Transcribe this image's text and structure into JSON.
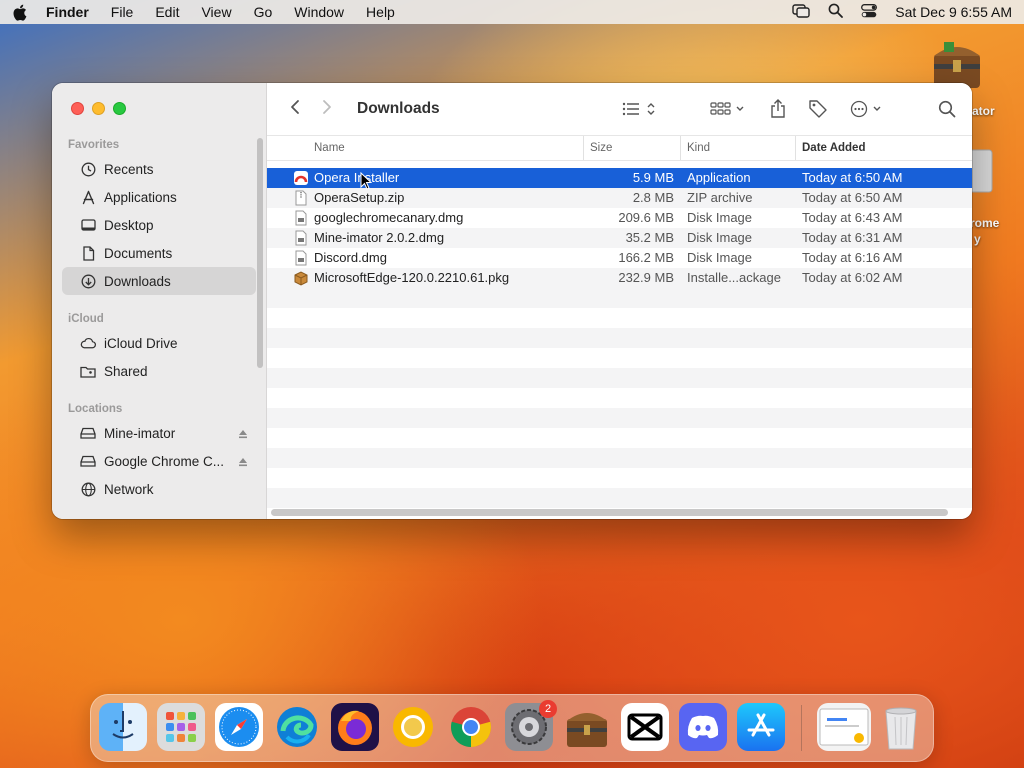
{
  "menubar": {
    "app_name": "Finder",
    "items": [
      "File",
      "Edit",
      "View",
      "Go",
      "Window",
      "Help"
    ],
    "datetime": "Sat Dec 9  6:55 AM"
  },
  "window": {
    "title": "Downloads",
    "sidebar": {
      "favorites_label": "Favorites",
      "favorites": [
        "Recents",
        "Applications",
        "Desktop",
        "Documents",
        "Downloads"
      ],
      "icloud_label": "iCloud",
      "icloud": [
        "iCloud Drive",
        "Shared"
      ],
      "locations_label": "Locations",
      "locations": [
        "Mine-imator",
        "Google Chrome C...",
        "Network"
      ]
    },
    "columns": {
      "name": "Name",
      "size": "Size",
      "kind": "Kind",
      "date_added": "Date Added"
    },
    "files": [
      {
        "name": "Opera Installer",
        "size": "5.9 MB",
        "kind": "Application",
        "date": "Today at 6:50 AM"
      },
      {
        "name": "OperaSetup.zip",
        "size": "2.8 MB",
        "kind": "ZIP archive",
        "date": "Today at 6:50 AM"
      },
      {
        "name": "googlechromecanary.dmg",
        "size": "209.6 MB",
        "kind": "Disk Image",
        "date": "Today at 6:43 AM"
      },
      {
        "name": "Mine-imator 2.0.2.dmg",
        "size": "35.2 MB",
        "kind": "Disk Image",
        "date": "Today at 6:31 AM"
      },
      {
        "name": "Discord.dmg",
        "size": "166.2 MB",
        "kind": "Disk Image",
        "date": "Today at 6:16 AM"
      },
      {
        "name": "MicrosoftEdge-120.0.2210.61.pkg",
        "size": "232.9 MB",
        "kind": "Installe...ackage",
        "date": "Today at 6:02 AM"
      }
    ]
  },
  "desktop": {
    "icon1_label": "ator",
    "icon2_label_a": "rome",
    "icon2_label_b": "y"
  },
  "dock": {
    "settings_badge": "2"
  },
  "colors": {
    "selection": "#1860d8",
    "accent": "#007aff"
  }
}
